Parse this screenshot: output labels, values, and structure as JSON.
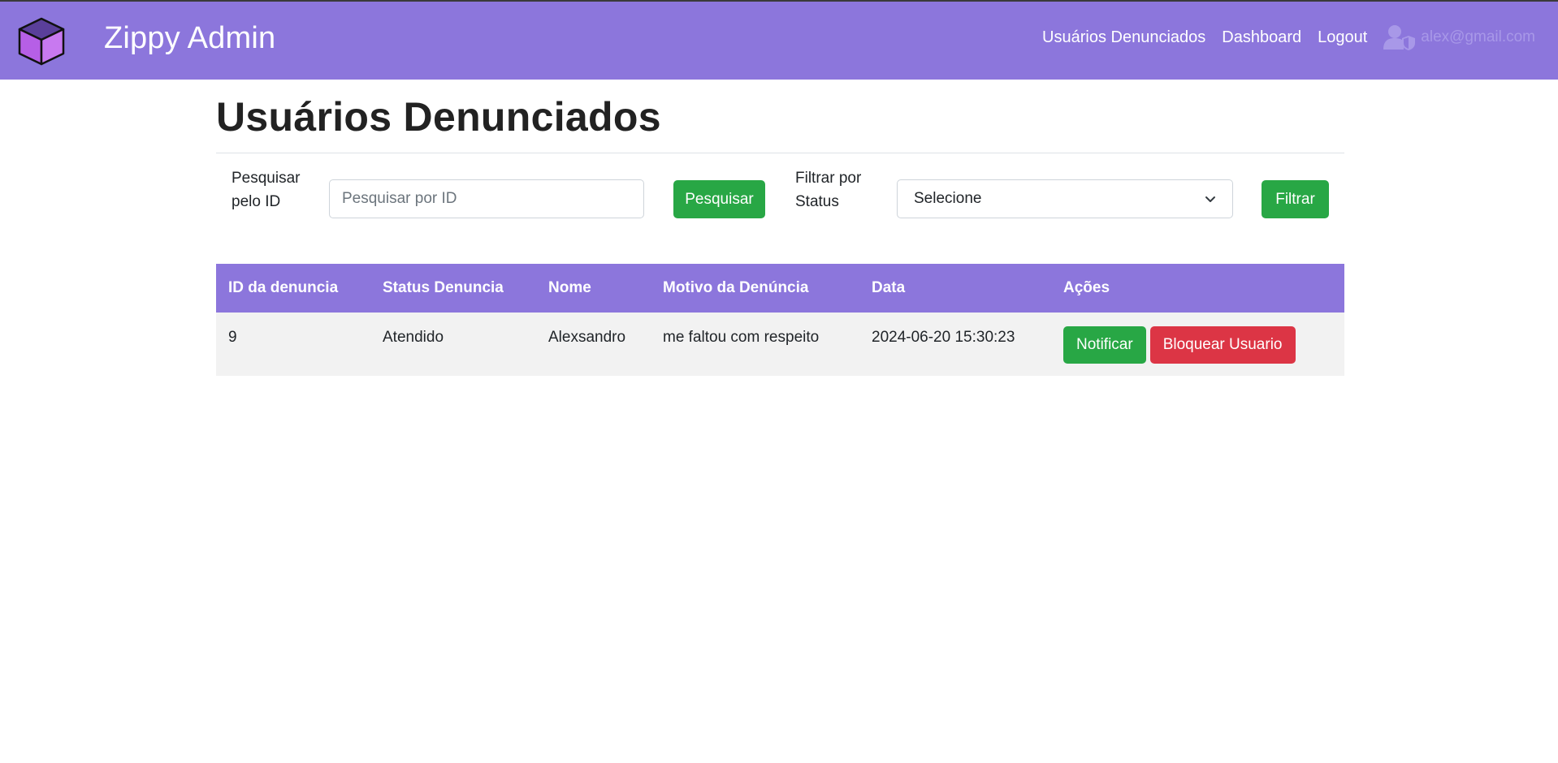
{
  "navbar": {
    "brand": "Zippy Admin",
    "links": [
      "Usuários Denunciados",
      "Dashboard",
      "Logout"
    ],
    "user_email": "alex@gmail.com",
    "bg_color": "#8c76dc"
  },
  "page": {
    "title": "Usuários Denunciados"
  },
  "search": {
    "label": "Pesquisar pelo ID",
    "placeholder": "Pesquisar por ID",
    "button": "Pesquisar"
  },
  "filter": {
    "label": "Filtrar por Status",
    "selected": "Selecione",
    "button": "Filtrar"
  },
  "table": {
    "headers": [
      "ID da denuncia",
      "Status Denuncia",
      "Nome",
      "Motivo da Denúncia",
      "Data",
      "Ações"
    ],
    "rows": [
      {
        "id": "9",
        "status": "Atendido",
        "nome": "Alexsandro",
        "motivo": "me faltou com respeito",
        "data": "2024-06-20 15:30:23",
        "notify_label": "Notificar",
        "block_label": "Bloquear Usuario"
      }
    ]
  },
  "colors": {
    "accent": "#8c76dc",
    "success": "#28a745",
    "danger": "#dc3545"
  },
  "icons": {
    "logo": "cube-icon",
    "user": "user-shield-icon",
    "select": "chevron-down-icon"
  }
}
